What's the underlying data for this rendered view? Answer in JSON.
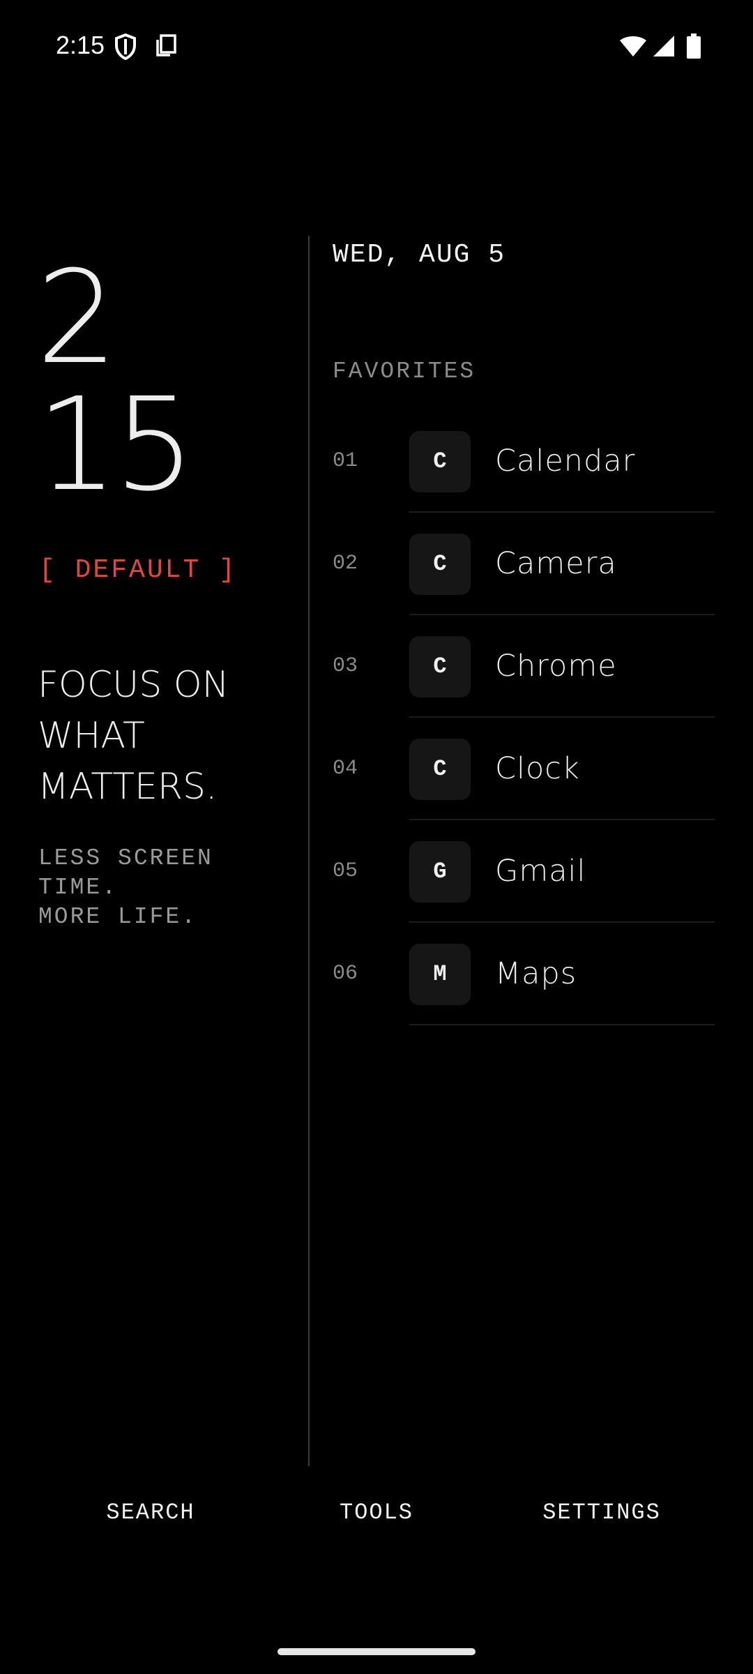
{
  "status_bar": {
    "time": "2:15",
    "icons": [
      "shield-icon",
      "screenshot-icon",
      "wifi-icon",
      "cell-signal-icon",
      "battery-icon"
    ]
  },
  "clock": {
    "hour": "2",
    "minute": "15"
  },
  "profile": {
    "label": "[ DEFAULT ]",
    "color": "#e0483e"
  },
  "tagline": [
    "FOCUS ON",
    "WHAT",
    "MATTERS."
  ],
  "subtag": [
    "LESS SCREEN",
    "TIME.",
    "MORE LIFE."
  ],
  "date": "WED, AUG 5",
  "favorites": {
    "title": "FAVORITES",
    "items": [
      {
        "num": "01",
        "initial": "C",
        "label": "Calendar"
      },
      {
        "num": "02",
        "initial": "C",
        "label": "Camera"
      },
      {
        "num": "03",
        "initial": "C",
        "label": "Chrome"
      },
      {
        "num": "04",
        "initial": "C",
        "label": "Clock"
      },
      {
        "num": "05",
        "initial": "G",
        "label": "Gmail"
      },
      {
        "num": "06",
        "initial": "M",
        "label": "Maps"
      }
    ]
  },
  "nav": {
    "search": "SEARCH",
    "tools": "TOOLS",
    "settings": "SETTINGS"
  }
}
